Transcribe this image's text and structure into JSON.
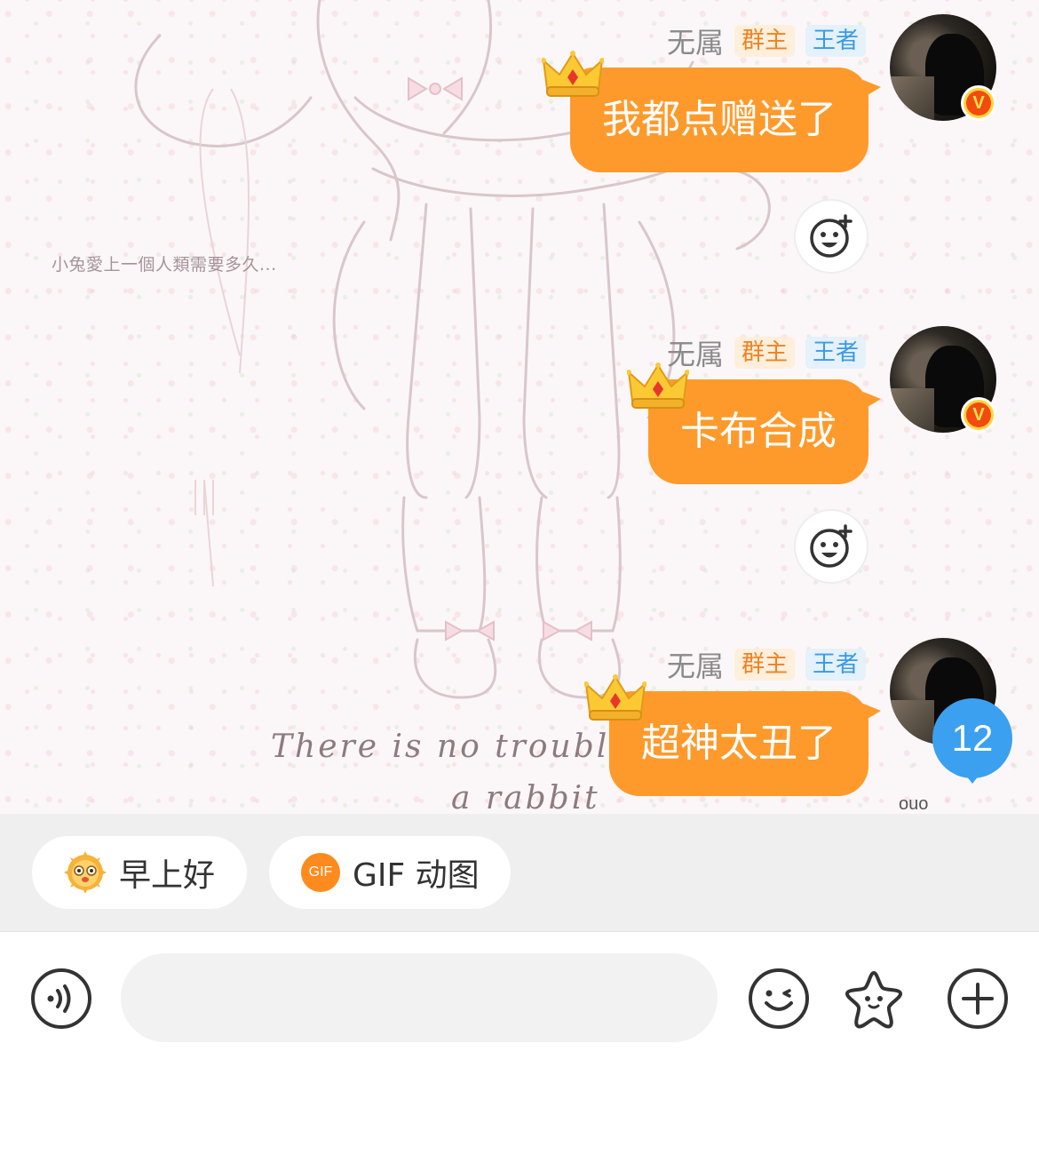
{
  "background": {
    "caption": "小兔愛上一個人類需要多久...",
    "script_line1": "There  is  no  trouble  i",
    "script_line2": "a  rabbit",
    "corner_tag": "ouo"
  },
  "messages": [
    {
      "sender": "无属",
      "role_tag": "群主",
      "rank_tag": "王者",
      "text": "我都点赠送了",
      "avatar_badge": "V"
    },
    {
      "sender": "无属",
      "role_tag": "群主",
      "rank_tag": "王者",
      "text": "卡布合成",
      "avatar_badge": "V"
    },
    {
      "sender": "无属",
      "role_tag": "群主",
      "rank_tag": "王者",
      "text": "超神太丑了"
    }
  ],
  "unread_count": "12",
  "quick_replies": [
    {
      "label": "早上好",
      "icon": "sun-emoji-icon"
    },
    {
      "label": "GIF 动图",
      "icon": "gif-icon",
      "icon_text": "GIF"
    }
  ],
  "input_bar": {
    "placeholder": "",
    "value": "",
    "icons": [
      "voice-icon",
      "emoji-icon",
      "star-sticker-icon",
      "plus-icon"
    ]
  },
  "colors": {
    "bubble": "#fe9a2b",
    "owner_tag": "#f08222",
    "rank_tag": "#3a9ae8",
    "unread_badge": "#3ca0f0"
  }
}
